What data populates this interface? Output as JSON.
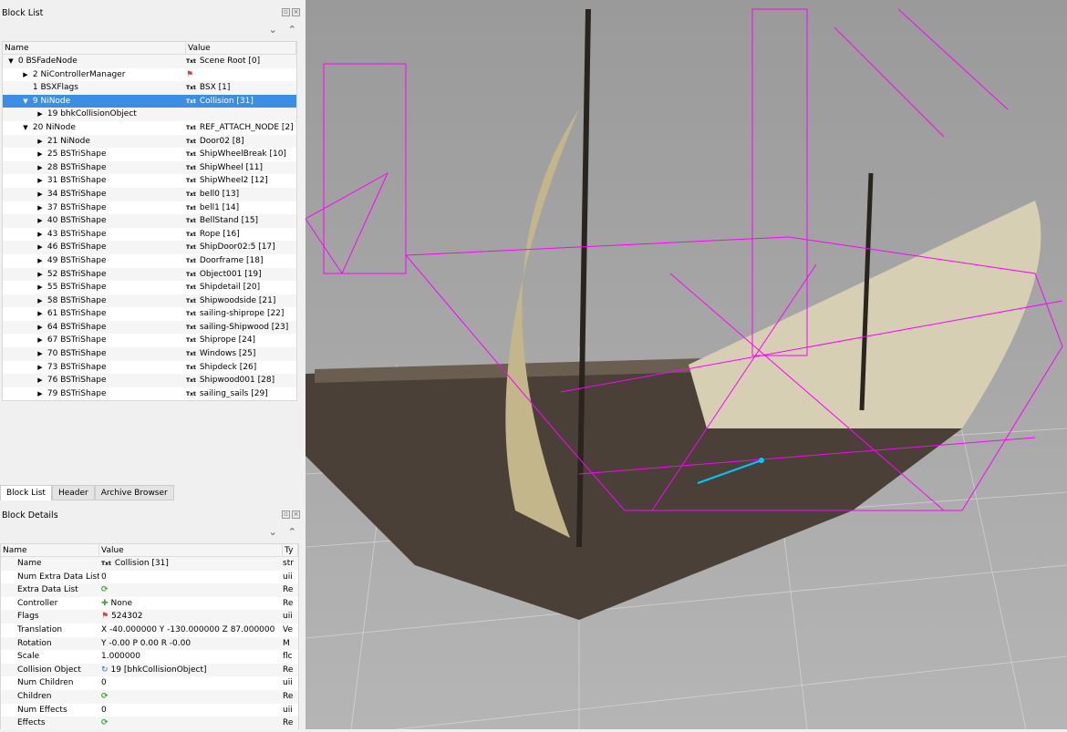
{
  "block_list": {
    "title": "Block List",
    "columns": [
      "Name",
      "Value"
    ],
    "rows": [
      {
        "name": "0 BSFadeNode",
        "value": "Scene Root [0]",
        "indent": 0,
        "arrow": "down",
        "icon": "txt"
      },
      {
        "name": "2 NiControllerManager",
        "value": "",
        "indent": 1,
        "arrow": "right",
        "icon": "flag"
      },
      {
        "name": "1 BSXFlags",
        "value": "BSX [1]",
        "indent": 1,
        "arrow": "",
        "icon": "txt"
      },
      {
        "name": "9 NiNode",
        "value": "Collision [31]",
        "indent": 1,
        "arrow": "down",
        "icon": "txt",
        "selected": true
      },
      {
        "name": "19 bhkCollisionObject",
        "value": "",
        "indent": 2,
        "arrow": "right",
        "icon": ""
      },
      {
        "name": "20 NiNode",
        "value": "REF_ATTACH_NODE [2]",
        "indent": 1,
        "arrow": "down",
        "icon": "txt"
      },
      {
        "name": "21 NiNode",
        "value": "Door02 [8]",
        "indent": 2,
        "arrow": "right",
        "icon": "txt"
      },
      {
        "name": "25 BSTriShape",
        "value": "ShipWheelBreak [10]",
        "indent": 2,
        "arrow": "right",
        "icon": "txt"
      },
      {
        "name": "28 BSTriShape",
        "value": "ShipWheel [11]",
        "indent": 2,
        "arrow": "right",
        "icon": "txt"
      },
      {
        "name": "31 BSTriShape",
        "value": "ShipWheel2 [12]",
        "indent": 2,
        "arrow": "right",
        "icon": "txt"
      },
      {
        "name": "34 BSTriShape",
        "value": "bell0 [13]",
        "indent": 2,
        "arrow": "right",
        "icon": "txt"
      },
      {
        "name": "37 BSTriShape",
        "value": "bell1 [14]",
        "indent": 2,
        "arrow": "right",
        "icon": "txt"
      },
      {
        "name": "40 BSTriShape",
        "value": "BellStand [15]",
        "indent": 2,
        "arrow": "right",
        "icon": "txt"
      },
      {
        "name": "43 BSTriShape",
        "value": "Rope [16]",
        "indent": 2,
        "arrow": "right",
        "icon": "txt"
      },
      {
        "name": "46 BSTriShape",
        "value": "ShipDoor02:5 [17]",
        "indent": 2,
        "arrow": "right",
        "icon": "txt"
      },
      {
        "name": "49 BSTriShape",
        "value": "Doorframe [18]",
        "indent": 2,
        "arrow": "right",
        "icon": "txt"
      },
      {
        "name": "52 BSTriShape",
        "value": "Object001 [19]",
        "indent": 2,
        "arrow": "right",
        "icon": "txt"
      },
      {
        "name": "55 BSTriShape",
        "value": "Shipdetail [20]",
        "indent": 2,
        "arrow": "right",
        "icon": "txt"
      },
      {
        "name": "58 BSTriShape",
        "value": "Shipwoodside [21]",
        "indent": 2,
        "arrow": "right",
        "icon": "txt"
      },
      {
        "name": "61 BSTriShape",
        "value": "sailing-shiprope [22]",
        "indent": 2,
        "arrow": "right",
        "icon": "txt"
      },
      {
        "name": "64 BSTriShape",
        "value": "sailing-Shipwood [23]",
        "indent": 2,
        "arrow": "right",
        "icon": "txt"
      },
      {
        "name": "67 BSTriShape",
        "value": "Shiprope [24]",
        "indent": 2,
        "arrow": "right",
        "icon": "txt"
      },
      {
        "name": "70 BSTriShape",
        "value": "Windows [25]",
        "indent": 2,
        "arrow": "right",
        "icon": "txt"
      },
      {
        "name": "73 BSTriShape",
        "value": "Shipdeck [26]",
        "indent": 2,
        "arrow": "right",
        "icon": "txt"
      },
      {
        "name": "76 BSTriShape",
        "value": "Shipwood001 [28]",
        "indent": 2,
        "arrow": "right",
        "icon": "txt"
      },
      {
        "name": "79 BSTriShape",
        "value": "sailing_sails [29]",
        "indent": 2,
        "arrow": "right",
        "icon": "txt"
      }
    ]
  },
  "tabs": [
    "Block List",
    "Header",
    "Archive Browser"
  ],
  "block_details": {
    "title": "Block Details",
    "columns": [
      "Name",
      "Value",
      "Ty"
    ],
    "rows": [
      {
        "name": "Name",
        "value": "Collision [31]",
        "type": "str",
        "icon": "txt"
      },
      {
        "name": "Num Extra Data List",
        "value": "0",
        "type": "uii",
        "icon": ""
      },
      {
        "name": "Extra Data List",
        "value": "",
        "type": "Re",
        "icon": "refresh"
      },
      {
        "name": "Controller",
        "value": "None",
        "type": "Re",
        "icon": "plus"
      },
      {
        "name": "Flags",
        "value": "524302",
        "type": "uii",
        "icon": "flag"
      },
      {
        "name": "Translation",
        "value": "X -40.000000 Y -130.000000 Z 87.000000",
        "type": "Ve",
        "icon": ""
      },
      {
        "name": "Rotation",
        "value": "Y -0.00 P 0.00 R -0.00",
        "type": "M",
        "icon": ""
      },
      {
        "name": "Scale",
        "value": "1.000000",
        "type": "flc",
        "icon": ""
      },
      {
        "name": "Collision Object",
        "value": "19 [bhkCollisionObject]",
        "type": "Re",
        "icon": "link"
      },
      {
        "name": "Num Children",
        "value": "0",
        "type": "uii",
        "icon": ""
      },
      {
        "name": "Children",
        "value": "",
        "type": "Re",
        "icon": "refresh"
      },
      {
        "name": "Num Effects",
        "value": "0",
        "type": "uii",
        "icon": ""
      },
      {
        "name": "Effects",
        "value": "",
        "type": "Re",
        "icon": "refresh"
      }
    ]
  },
  "colors": {
    "selection": "#3a8ee6",
    "wireframe": "#ff00ff",
    "accent": "#00c8ff"
  }
}
